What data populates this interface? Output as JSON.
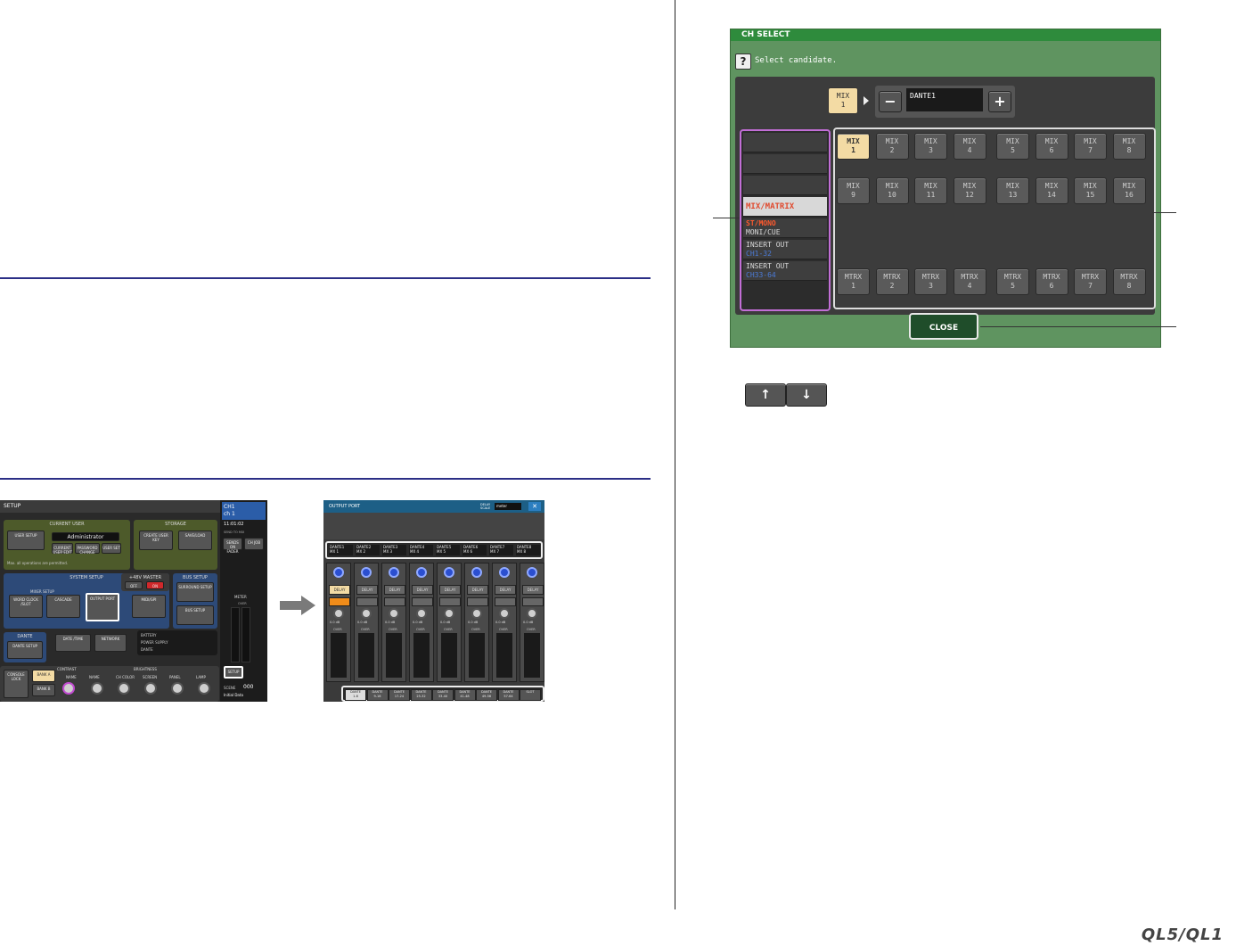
{
  "brand": "QL5/QL1",
  "ch_select": {
    "title": "CH SELECT",
    "prompt": "Select candidate.",
    "help_icon": "question-icon",
    "source_channel": {
      "line1": "MIX",
      "line2": "1"
    },
    "port": {
      "name": "DANTE1",
      "minus": "−",
      "plus": "+"
    },
    "categories": [
      {
        "line1": "",
        "line2": "",
        "active": false
      },
      {
        "line1": "",
        "line2": "",
        "active": false
      },
      {
        "line1": "",
        "line2": "",
        "active": false
      },
      {
        "line1": "MIX/MATRIX",
        "line2": "",
        "active": true
      },
      {
        "line1": "ST/MONO",
        "line2": "MONI/CUE",
        "active": false
      },
      {
        "line1": "INSERT OUT",
        "line2": "CH1-32",
        "active": false
      },
      {
        "line1": "INSERT OUT",
        "line2": "CH33-64",
        "active": false
      }
    ],
    "scroll_up_icon": "arrow-up-icon",
    "scroll_down_icon": "arrow-down-icon",
    "channels_row1": [
      [
        "MIX",
        "1"
      ],
      [
        "MIX",
        "2"
      ],
      [
        "MIX",
        "3"
      ],
      [
        "MIX",
        "4"
      ],
      [
        "MIX",
        "5"
      ],
      [
        "MIX",
        "6"
      ],
      [
        "MIX",
        "7"
      ],
      [
        "MIX",
        "8"
      ]
    ],
    "channels_row2": [
      [
        "MIX",
        "9"
      ],
      [
        "MIX",
        "10"
      ],
      [
        "MIX",
        "11"
      ],
      [
        "MIX",
        "12"
      ],
      [
        "MIX",
        "13"
      ],
      [
        "MIX",
        "14"
      ],
      [
        "MIX",
        "15"
      ],
      [
        "MIX",
        "16"
      ]
    ],
    "channels_row3": [
      [
        "MTRX",
        "1"
      ],
      [
        "MTRX",
        "2"
      ],
      [
        "MTRX",
        "3"
      ],
      [
        "MTRX",
        "4"
      ],
      [
        "MTRX",
        "5"
      ],
      [
        "MTRX",
        "6"
      ],
      [
        "MTRX",
        "7"
      ],
      [
        "MTRX",
        "8"
      ]
    ],
    "selected": "MIX 1",
    "close_label": "CLOSE"
  },
  "setup": {
    "title": "SETUP",
    "current_user": {
      "title": "CURRENT USER",
      "user_setup": "USER SETUP",
      "user_name": "Administrator",
      "current_user_edit": "CURRENT USER EDIT",
      "password_change": "PASSWORD CHANGE",
      "user_set": "USER SET",
      "note": "Max. all operations are permitted."
    },
    "storage": {
      "title": "STORAGE",
      "create_user_key": "CREATE USER KEY",
      "save_load": "SAVE/LOAD"
    },
    "system_setup": {
      "title": "SYSTEM SETUP",
      "mixer_setup": "MIXER SETUP",
      "word_clock": "WORD CLOCK /SLOT",
      "cascade": "CASCADE",
      "output_port": "OUTPUT PORT",
      "midi_gpi": "MIDI/GPI"
    },
    "phantom": {
      "title": "+48V MASTER",
      "off": "OFF",
      "on": "ON"
    },
    "bus_setup": {
      "title": "BUS SETUP",
      "surround": "SURROUND SETUP",
      "bus": "BUS SETUP"
    },
    "dante": {
      "title": "DANTE",
      "dante_setup": "DANTE SETUP"
    },
    "date_time": "DATE /TIME",
    "network": "NETWORK",
    "status": [
      "BATTERY",
      "POWER SUPPLY",
      "DANTE"
    ],
    "console_lock": "CONSOLE LOCK",
    "bank_a": "BANK A",
    "bank_b": "BANK B",
    "contrast": {
      "title": "CONTRAST",
      "name": "NAME"
    },
    "brightness": {
      "title": "BRIGHTNESS",
      "items": [
        "NAME",
        "CH COLOR",
        "SCREEN",
        "PANEL",
        "LAMP"
      ]
    },
    "side": {
      "ch": "CH1",
      "ch_name": "ch 1",
      "time": "11:01:02",
      "send_to_aux": "SEND TO MIX",
      "sends_on_fader": "SENDS ON FADER",
      "ch_job": "CH JOB",
      "meter": "METER",
      "over": "OVER",
      "setup": "SETUP",
      "scene_label": "SCENE",
      "scene_no": "000",
      "scene_name": "Initial Data"
    }
  },
  "output_port": {
    "title": "OUTPUT PORT",
    "delay_scale_label": "DELAY SCALE",
    "delay_scale_value": "meter",
    "close_icon": "close-icon",
    "ports": [
      {
        "port": "DANTE1",
        "name": "MX 1"
      },
      {
        "port": "DANTE2",
        "name": "MX 2"
      },
      {
        "port": "DANTE3",
        "name": "MX 3"
      },
      {
        "port": "DANTE4",
        "name": "MX 4"
      },
      {
        "port": "DANTE5",
        "name": "MX 5"
      },
      {
        "port": "DANTE6",
        "name": "MX 6"
      },
      {
        "port": "DANTE7",
        "name": "MX 7"
      },
      {
        "port": "DANTE8",
        "name": "MX 8"
      }
    ],
    "delay_label": "DELAY",
    "delay_states": [
      true,
      false,
      false,
      false,
      false,
      false,
      false,
      false
    ],
    "phase_states": [
      true,
      false,
      false,
      false,
      false,
      false,
      false,
      false
    ],
    "gain_label": "0.0 dB",
    "meter_top": "OVER",
    "banks": [
      {
        "line1": "DANTE",
        "line2": "1-8",
        "selected": true
      },
      {
        "line1": "DANTE",
        "line2": "9-16",
        "selected": false
      },
      {
        "line1": "DANTE",
        "line2": "17-24",
        "selected": false
      },
      {
        "line1": "DANTE",
        "line2": "25-32",
        "selected": false
      },
      {
        "line1": "DANTE",
        "line2": "33-40",
        "selected": false
      },
      {
        "line1": "DANTE",
        "line2": "41-48",
        "selected": false
      },
      {
        "line1": "DANTE",
        "line2": "49-56",
        "selected": false
      },
      {
        "line1": "DANTE",
        "line2": "57-64",
        "selected": false
      },
      {
        "line1": "SLOT",
        "line2": "",
        "selected": false
      }
    ]
  },
  "colors": {
    "rule": "#2b2f86",
    "dialog_bg": "#5f9460",
    "title_bar": "#2e8b3c",
    "selected": "#f3dba4",
    "active_category": "#e04a2e",
    "sub_blue": "#4b7bd8"
  }
}
